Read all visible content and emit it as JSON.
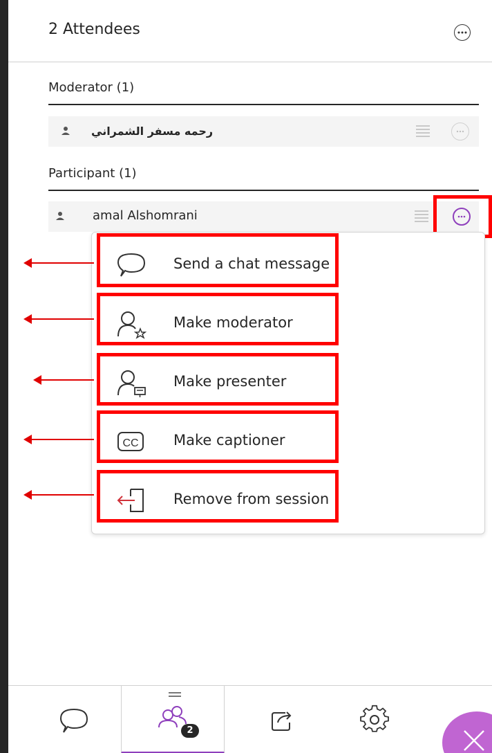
{
  "header": {
    "title": "2 Attendees",
    "more_icon": "more-options-icon"
  },
  "sections": {
    "moderator": {
      "title": "Moderator (1)",
      "attendee": {
        "name": "رحمه مسفر الشمراني",
        "icon": "person-icon"
      }
    },
    "participant": {
      "title": "Participant (1)",
      "attendee": {
        "name": "amal Alshomrani",
        "icon": "person-icon"
      }
    }
  },
  "menu": {
    "items": [
      {
        "label": "Send a chat message",
        "icon": "chat-bubble-icon"
      },
      {
        "label": "Make moderator",
        "icon": "person-star-icon"
      },
      {
        "label": "Make presenter",
        "icon": "person-presenter-icon"
      },
      {
        "label": "Make captioner",
        "icon": "captions-cc-icon"
      },
      {
        "label": "Remove from session",
        "icon": "remove-exit-icon"
      }
    ]
  },
  "bottom_bar": {
    "items": [
      "chat-icon",
      "attendees-icon",
      "share-content-icon",
      "settings-icon",
      "close-icon"
    ],
    "attendee_badge": "2"
  },
  "colors": {
    "accent": "#8e3fbc",
    "highlight": "#ff0000",
    "fab": "#c065d2"
  }
}
